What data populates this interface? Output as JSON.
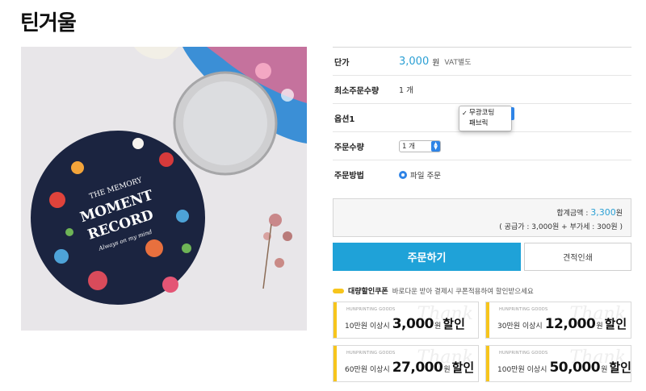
{
  "page": {
    "title": "틴거울"
  },
  "spec": {
    "price_label": "단가",
    "price_value": "3,000",
    "price_unit": "원",
    "vat_note": "VAT별도",
    "min_qty_label": "최소주문수량",
    "min_qty_value": "1 개",
    "option_label": "옵션1",
    "option_items": [
      "무광코팅",
      "패브릭"
    ],
    "option_selected": "무광코팅",
    "qty_label": "주문수량",
    "qty_value": "1 개",
    "method_label": "주문방법",
    "method_value": "파일 주문"
  },
  "total": {
    "line1_prefix": "합계금액 : ",
    "line1_amount": "3,300",
    "line1_suffix": "원",
    "line2": "( 공급가 : 3,000원 + 부가세 : 300원 )"
  },
  "actions": {
    "order_label": "주문하기",
    "quote_label": "견적인쇄"
  },
  "coupon": {
    "title": "대량할인쿠폰",
    "desc": "바로다운 받아 결제시 쿠폰적용하여 할인받으세요",
    "brand": "HUNPRINTING GOODS",
    "deco": "Thank",
    "won": "원",
    "off": "할인",
    "cards": [
      {
        "cond": "10만원 이상시",
        "amount": "3,000"
      },
      {
        "cond": "30만원 이상시",
        "amount": "12,000"
      },
      {
        "cond": "60만원 이상시",
        "amount": "27,000"
      },
      {
        "cond": "100만원 이상시",
        "amount": "50,000"
      }
    ]
  },
  "image": {
    "mirror_line1": "THE MEMORY",
    "mirror_line2": "MOMENT",
    "mirror_line3": "RECORD",
    "mirror_line4": "Always on my mind"
  },
  "colors": {
    "accent": "#1fa2d8",
    "price": "#2a9fd4",
    "coupon_yellow": "#f7c51c",
    "select_blue": "#2f84e6"
  },
  "icons": {
    "check": "check-icon",
    "stepper": "updown-stepper-icon",
    "radio": "radio-selected-icon",
    "coupon_pill": "coupon-pill-icon"
  }
}
